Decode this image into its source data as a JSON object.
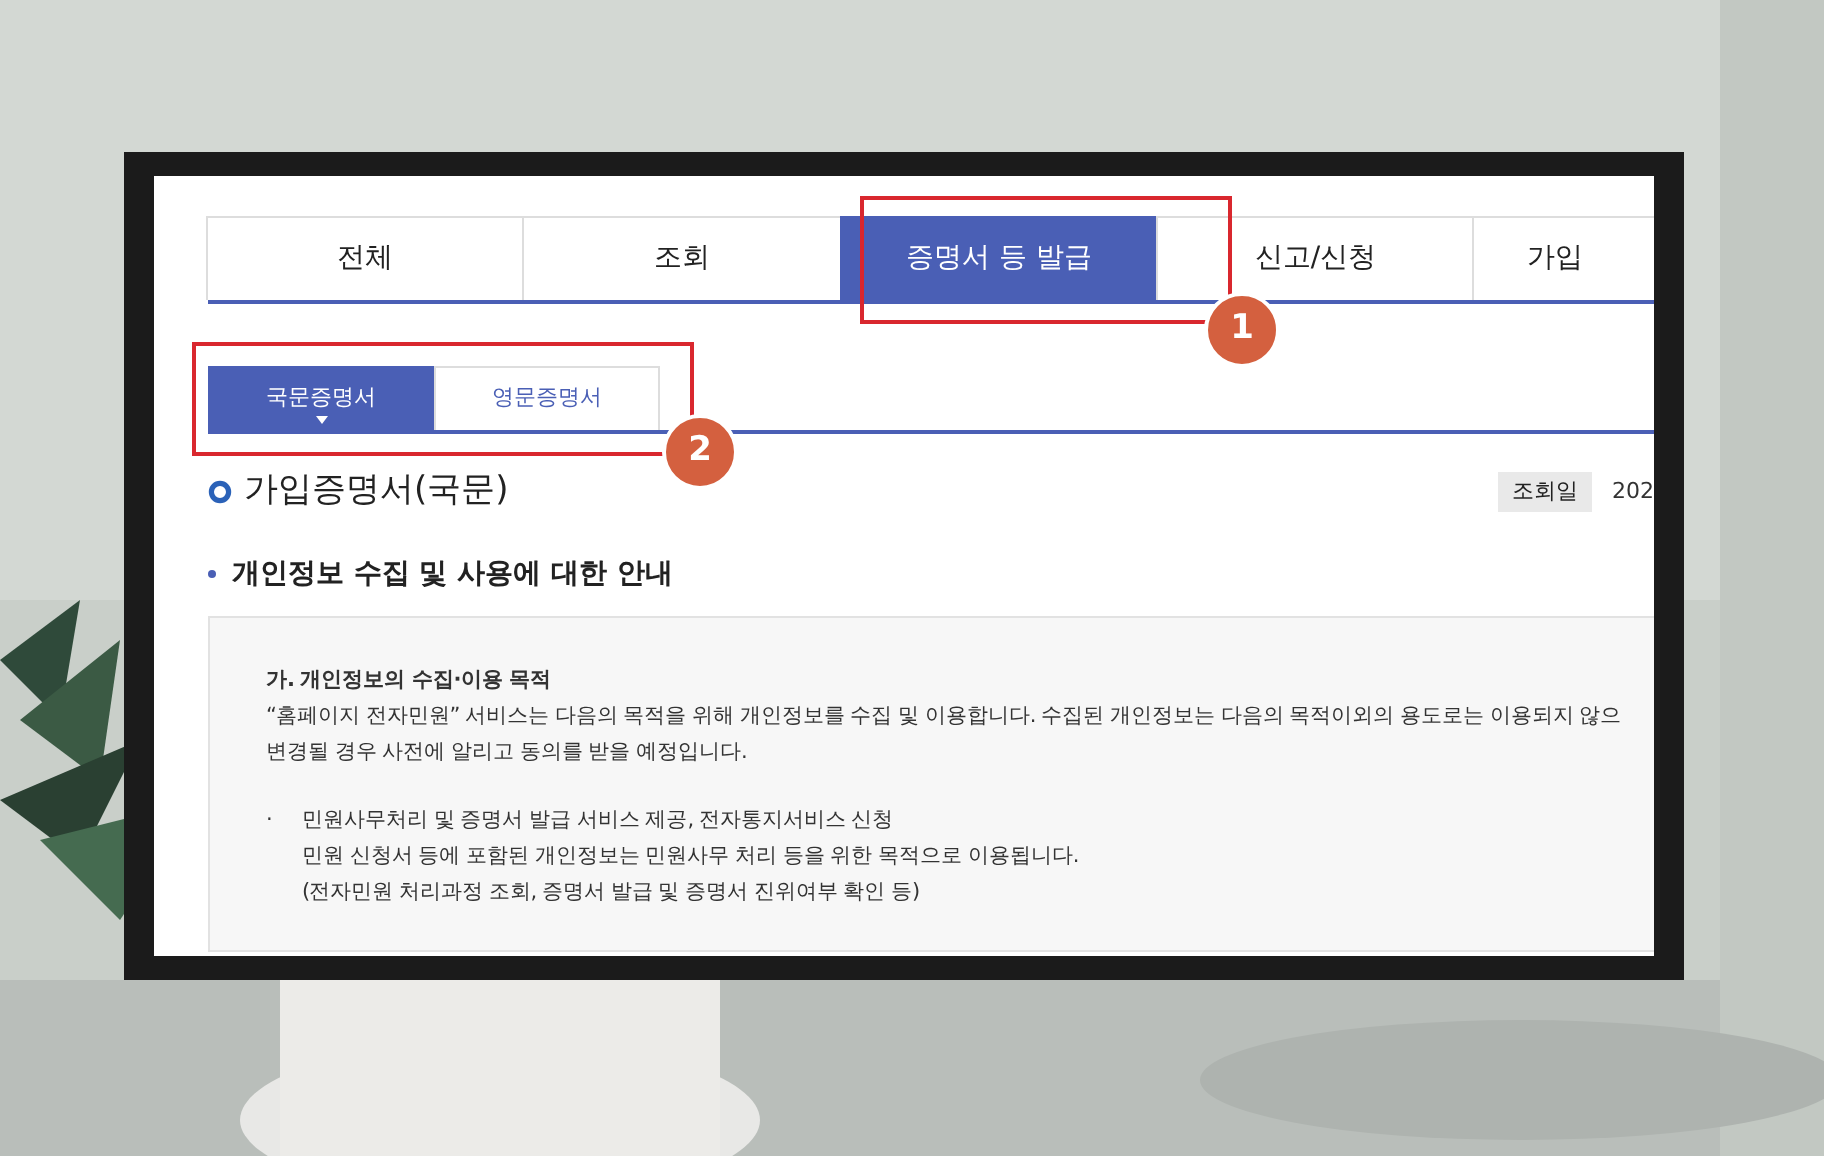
{
  "tabs": [
    {
      "label": "전체",
      "selected": false
    },
    {
      "label": "조회",
      "selected": false
    },
    {
      "label": "증명서 등 발급",
      "selected": true
    },
    {
      "label": "신고/신청",
      "selected": false
    },
    {
      "label": "가입",
      "selected": false
    }
  ],
  "subtabs": [
    {
      "label": "국문증명서",
      "selected": true
    },
    {
      "label": "영문증명서",
      "selected": false
    }
  ],
  "page_title": "가입증명서(국문)",
  "query_date": {
    "label": "조회일",
    "value": "202"
  },
  "section_title": "개인정보 수집 및 사용에 대한 안내",
  "notice": {
    "heading": "가. 개인정보의 수집·이용 목적",
    "lines": [
      "“홈페이지 전자민원” 서비스는 다음의 목적을 위해 개인정보를 수집 및 이용합니다. 수집된 개인정보는 다음의 목적이외의 용도로는 이용되지 않으",
      "변경될 경우 사전에 알리고 동의를 받을 예정입니다."
    ],
    "bullets": [
      {
        "marker": "·",
        "lines": [
          "민원사무처리 및 증명서 발급 서비스 제공, 전자통지서비스 신청",
          "민원 신청서 등에 포함된 개인정보는 민원사무 처리 등을 위한 목적으로 이용됩니다.",
          "(전자민원 처리과정 조회, 증명서 발급 및 증명서 진위여부 확인 등)"
        ]
      }
    ]
  },
  "callouts": [
    {
      "number": "1"
    },
    {
      "number": "2"
    }
  ]
}
